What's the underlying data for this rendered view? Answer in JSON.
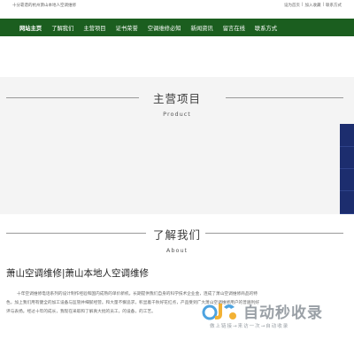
{
  "topbar": {
    "tagline": "十分靠谱的杭州萧山本地人空调维修",
    "links": [
      "设为首页",
      "|",
      "加入收藏",
      "|",
      "联系方式"
    ]
  },
  "nav": {
    "items": [
      "网站主页",
      "了解我们",
      "主营项目",
      "证书荣誉",
      "空调维修必知",
      "新闻资讯",
      "留言在线",
      "联系方式"
    ],
    "background": "#1b5e1f"
  },
  "products": {
    "title": "主营项目",
    "subtitle": "Product"
  },
  "about": {
    "title": "了解我们",
    "subtitle": "About",
    "heading": "萧山空调维修|萧山本地人空调维修",
    "paragraph": "十年空调维修电话系列的设计制作经验和国内成熟的单价新机，长期提供我们自身的科学技术企业金，连成了萧山空调维修商品的特色，加上我们用有健全的加工设备与监管并细腻经营。和大量不懈追求，彰显着千秋好花红点，产品受到广大萧山空调维修用户的普遍利好评与表扬。经过十年的成长，我现在采取和了解真大批的员工，的设备，的工艺。"
  },
  "sidebar": {
    "color": "#1c2d6e"
  },
  "watermark": {
    "name": "自动秒收录",
    "slogan": "做上链接→来访一次→自动收录"
  }
}
